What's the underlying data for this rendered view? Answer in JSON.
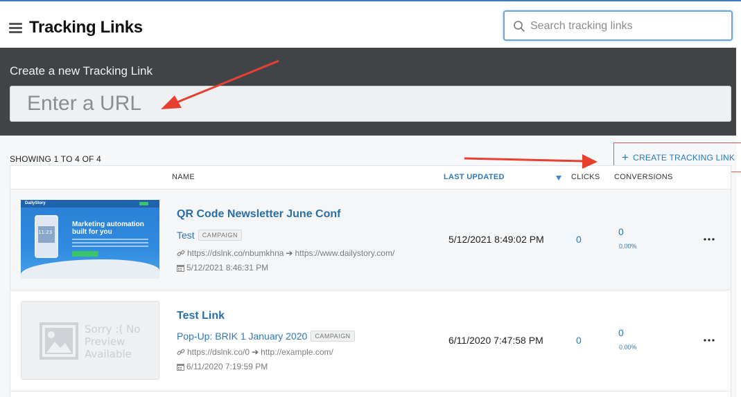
{
  "header": {
    "title": "Tracking Links",
    "search_placeholder": "Search tracking links"
  },
  "create": {
    "label": "Create a new Tracking Link",
    "url_placeholder": "Enter a URL"
  },
  "list": {
    "showing": "SHOWING 1 TO 4 OF 4",
    "create_button": "CREATE TRACKING LINK",
    "columns": {
      "name": "NAME",
      "last_updated": "LAST UPDATED",
      "clicks": "CLICKS",
      "conversions": "CONVERSIONS"
    },
    "rows": [
      {
        "name": "QR Code Newsletter June Conf",
        "campaign": "Test",
        "badge": "CAMPAIGN",
        "short_url": "https://dslnk.co/nbumkhna",
        "target_url": "https://www.dailystory.com/",
        "created": "5/12/2021 8:46:31 PM",
        "last_updated": "5/12/2021 8:49:02 PM",
        "clicks": "0",
        "conversions": "0",
        "conversion_rate": "0.00%",
        "preview": {
          "logo": "DailyStory",
          "headline": "Marketing automation built for you",
          "time": "11:23"
        }
      },
      {
        "name": "Test Link",
        "campaign": "Pop-Up: BRIK 1 January 2020",
        "badge": "CAMPAIGN",
        "short_url": "https://dslnk.co/0",
        "target_url": "http://example.com/",
        "created": "6/11/2020 7:19:59 PM",
        "last_updated": "6/11/2020 7:47:58 PM",
        "clicks": "0",
        "conversions": "0",
        "conversion_rate": "0.00%",
        "preview": {
          "no_preview_text": "Sorry :( No Preview Available"
        }
      }
    ]
  },
  "colors": {
    "accent": "#2a78b9",
    "panel": "#404447",
    "annotation": "#e8402f"
  }
}
